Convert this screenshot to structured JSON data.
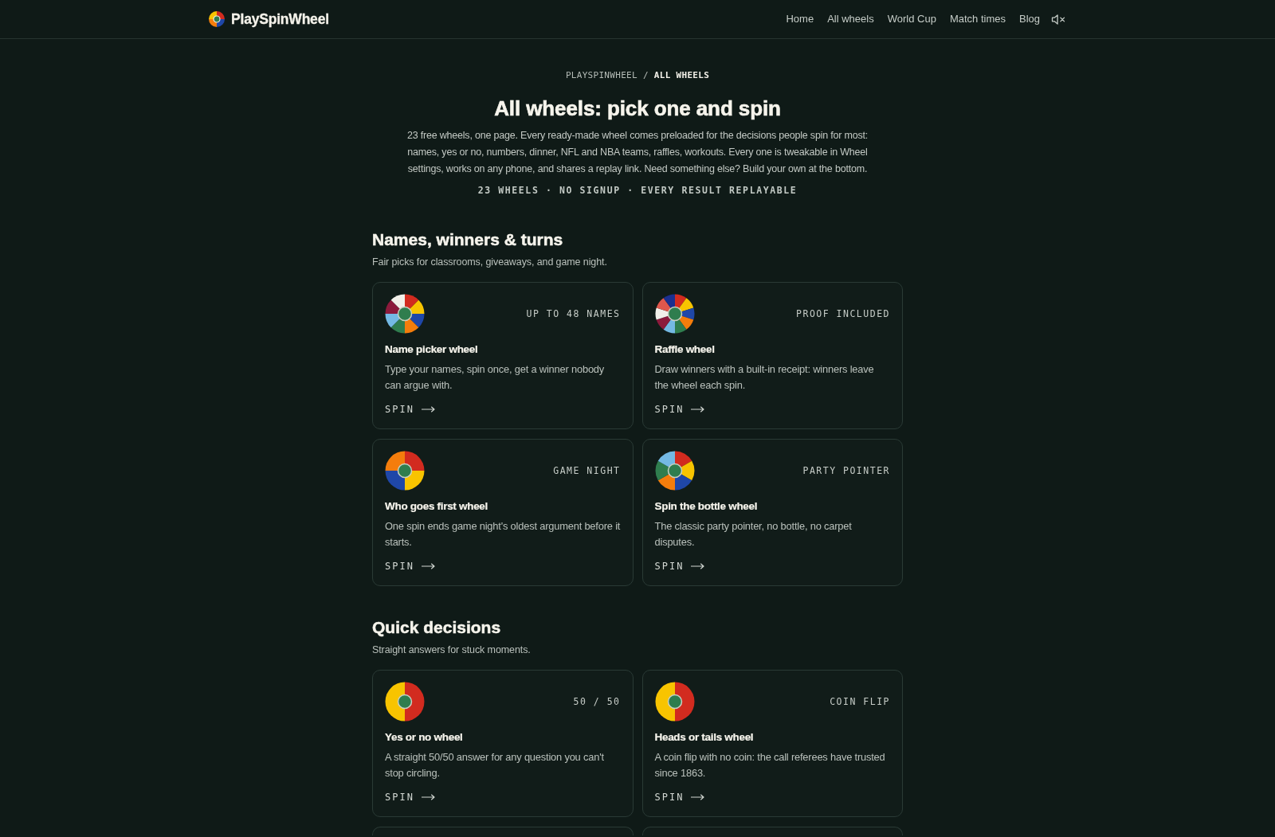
{
  "header": {
    "site_name": "PlaySpinWheel",
    "nav": [
      "Home",
      "All wheels",
      "World Cup",
      "Match times",
      "Blog"
    ],
    "sound": {
      "muted": true
    }
  },
  "breadcrumb": {
    "items": [
      {
        "label": "PLAYSPINWHEEL",
        "current": false
      },
      {
        "label": "ALL WHEELS",
        "current": true
      }
    ],
    "separator": "/"
  },
  "hero": {
    "title": "All wheels: pick one and spin",
    "intro": "23 free wheels, one page. Every ready-made wheel comes preloaded for the decisions people spin for most: names, yes or no, numbers, dinner, NFL and NBA teams, raffles, workouts. Every one is tweakable in Wheel settings, works on any phone, and shares a replay link. Need something else? Build your own at the bottom.",
    "tagline": "23 WHEELS · NO SIGNUP · EVERY RESULT REPLAYABLE"
  },
  "sections": [
    {
      "heading": "Names, winners & turns",
      "subtitle": "Fair picks for classrooms, giveaways, and game night.",
      "cards": [
        {
          "kind": "wheel",
          "segments": [
            {
              "color": "#d22b1f"
            },
            {
              "color": "#f8c400"
            },
            {
              "color": "#1f47a8"
            },
            {
              "color": "#f47d0c"
            },
            {
              "color": "#2f7d4e"
            },
            {
              "color": "#74b9e4"
            },
            {
              "color": "#8c1a3c"
            },
            {
              "color": "#f2f0ea"
            }
          ],
          "tag": "UP TO 48 NAMES",
          "title": "Name picker wheel",
          "description": "Type your names, spin once, get a winner nobody can argue with.",
          "action": "SPIN"
        },
        {
          "kind": "wheel",
          "segments": [
            {
              "color": "#d22b1f"
            },
            {
              "color": "#f8c400"
            },
            {
              "color": "#1f47a8"
            },
            {
              "color": "#f47d0c"
            },
            {
              "color": "#2f7d4e"
            },
            {
              "color": "#74b9e4"
            },
            {
              "color": "#8c1a3c"
            },
            {
              "color": "#f2f0ea"
            },
            {
              "color": "#e0574c"
            },
            {
              "color": "#1b2f8f"
            }
          ],
          "tag": "PROOF INCLUDED",
          "title": "Raffle wheel",
          "description": "Draw winners with a built-in receipt: winners leave the wheel each spin.",
          "action": "SPIN"
        },
        {
          "kind": "wheel",
          "segments": [
            {
              "color": "#d22b1f"
            },
            {
              "color": "#f8c400"
            },
            {
              "color": "#1f47a8"
            },
            {
              "color": "#f47d0c"
            }
          ],
          "tag": "GAME NIGHT",
          "title": "Who goes first wheel",
          "description": "One spin ends game night's oldest argument before it starts.",
          "action": "SPIN"
        },
        {
          "kind": "wheel",
          "segments": [
            {
              "color": "#d22b1f"
            },
            {
              "color": "#f8c400"
            },
            {
              "color": "#1f47a8"
            },
            {
              "color": "#f47d0c"
            },
            {
              "color": "#2f7d4e"
            },
            {
              "color": "#74b9e4"
            }
          ],
          "tag": "PARTY POINTER",
          "title": "Spin the bottle wheel",
          "description": "The classic party pointer, no bottle, no carpet disputes.",
          "action": "SPIN"
        }
      ]
    },
    {
      "heading": "Quick decisions",
      "subtitle": "Straight answers for stuck moments.",
      "cards": [
        {
          "kind": "wheel",
          "segments": [
            {
              "color": "#d22b1f"
            },
            {
              "color": "#f8c400"
            }
          ],
          "tag": "50 / 50",
          "title": "Yes or no wheel",
          "description": "A straight 50/50 answer for any question you can't stop circling.",
          "action": "SPIN"
        },
        {
          "kind": "wheel",
          "segments": [
            {
              "color": "#d22b1f"
            },
            {
              "color": "#f8c400"
            }
          ],
          "tag": "COIN FLIP",
          "title": "Heads or tails wheel",
          "description": "A coin flip with no coin: the call referees have trusted since 1863.",
          "action": "SPIN"
        },
        {
          "kind": "cut_off"
        },
        {
          "kind": "cut_off"
        }
      ]
    }
  ]
}
